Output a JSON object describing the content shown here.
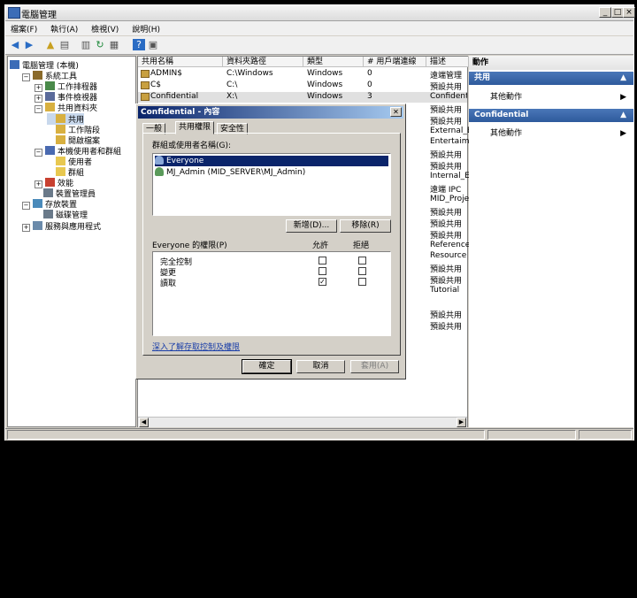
{
  "window": {
    "title": "電腦管理"
  },
  "menu": [
    "檔案(F)",
    "執行(A)",
    "檢視(V)",
    "說明(H)"
  ],
  "tree": [
    {
      "label": "電腦管理 (本機)",
      "indent": 0,
      "exp": ""
    },
    {
      "label": "系統工具",
      "indent": 1,
      "exp": "−"
    },
    {
      "label": "工作排程器",
      "indent": 2,
      "exp": "+"
    },
    {
      "label": "事件檢視器",
      "indent": 2,
      "exp": "+"
    },
    {
      "label": "共用資料夾",
      "indent": 2,
      "exp": "−"
    },
    {
      "label": "共用",
      "indent": 3,
      "exp": ""
    },
    {
      "label": "工作階段",
      "indent": 3,
      "exp": ""
    },
    {
      "label": "開啟檔案",
      "indent": 3,
      "exp": ""
    },
    {
      "label": "本機使用者和群組",
      "indent": 2,
      "exp": "−"
    },
    {
      "label": "使用者",
      "indent": 3,
      "exp": ""
    },
    {
      "label": "群組",
      "indent": 3,
      "exp": ""
    },
    {
      "label": "效能",
      "indent": 2,
      "exp": "+"
    },
    {
      "label": "裝置管理員",
      "indent": 2,
      "exp": ""
    },
    {
      "label": "存放裝置",
      "indent": 1,
      "exp": "−"
    },
    {
      "label": "磁碟管理",
      "indent": 2,
      "exp": ""
    },
    {
      "label": "服務與應用程式",
      "indent": 1,
      "exp": "+"
    }
  ],
  "shares": {
    "headers": [
      "共用名稱",
      "資料夾路徑",
      "類型",
      "# 用戶端連線",
      "描述"
    ],
    "rows": [
      [
        "ADMIN$",
        "C:\\Windows",
        "Windows",
        "0",
        "遠端管理"
      ],
      [
        "C$",
        "C:\\",
        "Windows",
        "0",
        "預設共用"
      ],
      [
        "Confidential",
        "X:\\",
        "Windows",
        "3",
        "Confidentia"
      ]
    ],
    "descriptions": [
      "預設共用",
      "預設共用",
      "External_Ex",
      "Entertaimen",
      "預設共用",
      "預設共用",
      "Internal_Ex",
      "遠端 IPC",
      "MID_Projec",
      "預設共用",
      "預設共用",
      "預設共用",
      "Reference",
      "Resource",
      "預設共用",
      "預設共用",
      "Tutorial",
      "",
      "預設共用",
      "預設共用"
    ]
  },
  "actions": {
    "header": "動作",
    "sections": [
      {
        "title": "共用",
        "item": "其他動作"
      },
      {
        "title": "Confidential",
        "item": "其他動作"
      }
    ]
  },
  "dialog": {
    "title": "Confidential - 內容",
    "tabs": [
      "一般",
      "共用權限",
      "安全性"
    ],
    "users_label": "群組或使用者名稱(G):",
    "users": [
      "Everyone",
      "MJ_Admin (MID_SERVER\\MJ_Admin)"
    ],
    "add_button": "新增(D)...",
    "remove_button": "移除(R)",
    "perm_label": "Everyone 的權限(P)",
    "allow_label": "允許",
    "deny_label": "拒絕",
    "permissions": [
      {
        "name": "完全控制",
        "allow": false,
        "deny": false
      },
      {
        "name": "變更",
        "allow": false,
        "deny": false
      },
      {
        "name": "讀取",
        "allow": true,
        "deny": false
      }
    ],
    "link": "深入了解存取控制及權限",
    "ok": "確定",
    "cancel": "取消",
    "apply": "套用(A)"
  }
}
